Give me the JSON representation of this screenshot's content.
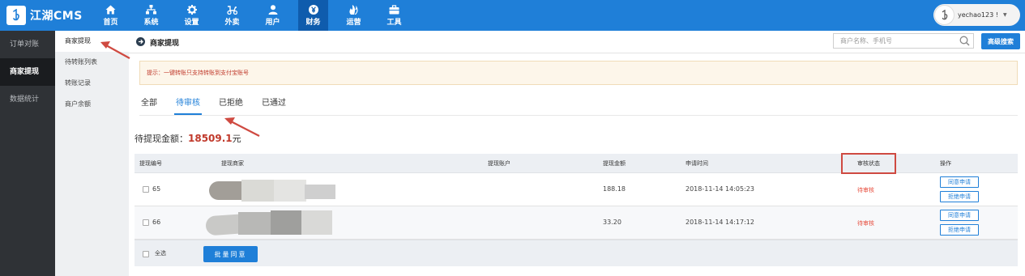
{
  "app": {
    "logo_text": "江湖CMS"
  },
  "topnav": [
    {
      "label": "首页",
      "icon": "home-icon"
    },
    {
      "label": "系统",
      "icon": "sitemap-icon"
    },
    {
      "label": "设置",
      "icon": "gear-icon"
    },
    {
      "label": "外卖",
      "icon": "scooter-icon"
    },
    {
      "label": "用户",
      "icon": "user-icon"
    },
    {
      "label": "财务",
      "icon": "yen-icon",
      "active": true
    },
    {
      "label": "运营",
      "icon": "flame-icon"
    },
    {
      "label": "工具",
      "icon": "briefcase-icon"
    }
  ],
  "user": {
    "name": "yechao123 !"
  },
  "sidebar": {
    "items": [
      {
        "label": "订单对账"
      },
      {
        "label": "商家提现",
        "active": true
      },
      {
        "label": "数据统计"
      }
    ]
  },
  "subnav": {
    "items": [
      {
        "label": "商家提现",
        "active": true
      },
      {
        "label": "待转账列表"
      },
      {
        "label": "转账记录"
      },
      {
        "label": "商户余额"
      }
    ]
  },
  "header": {
    "title": "商家提现",
    "search_placeholder": "商户名称、手机号",
    "adv_search_label": "高级搜索"
  },
  "tip": "提示：一键转账只支持转账到支付宝账号",
  "tabs": [
    {
      "label": "全部"
    },
    {
      "label": "待审核",
      "active": true
    },
    {
      "label": "已拒绝"
    },
    {
      "label": "已通过"
    }
  ],
  "pending": {
    "label": "待提现金额：",
    "amount": "18509.1",
    "unit": "元"
  },
  "table": {
    "columns": [
      "提现编号",
      "提现商家",
      "提现账户",
      "提现金额",
      "申请时间",
      "审核状态",
      "操作"
    ],
    "rows": [
      {
        "id": "65",
        "amount": "188.18",
        "time": "2018-11-14 14:05:23",
        "status": "待审核"
      },
      {
        "id": "66",
        "amount": "33.20",
        "time": "2018-11-14 14:17:12",
        "status": "待审核"
      }
    ],
    "actions": {
      "approve": "同意申请",
      "reject": "拒绝申请"
    },
    "select_all": "全选",
    "batch_label": "批量同意"
  },
  "colors": {
    "primary": "#1f7fd8",
    "accent_red": "#c0392b",
    "sidebar_bg": "#2f3236"
  }
}
